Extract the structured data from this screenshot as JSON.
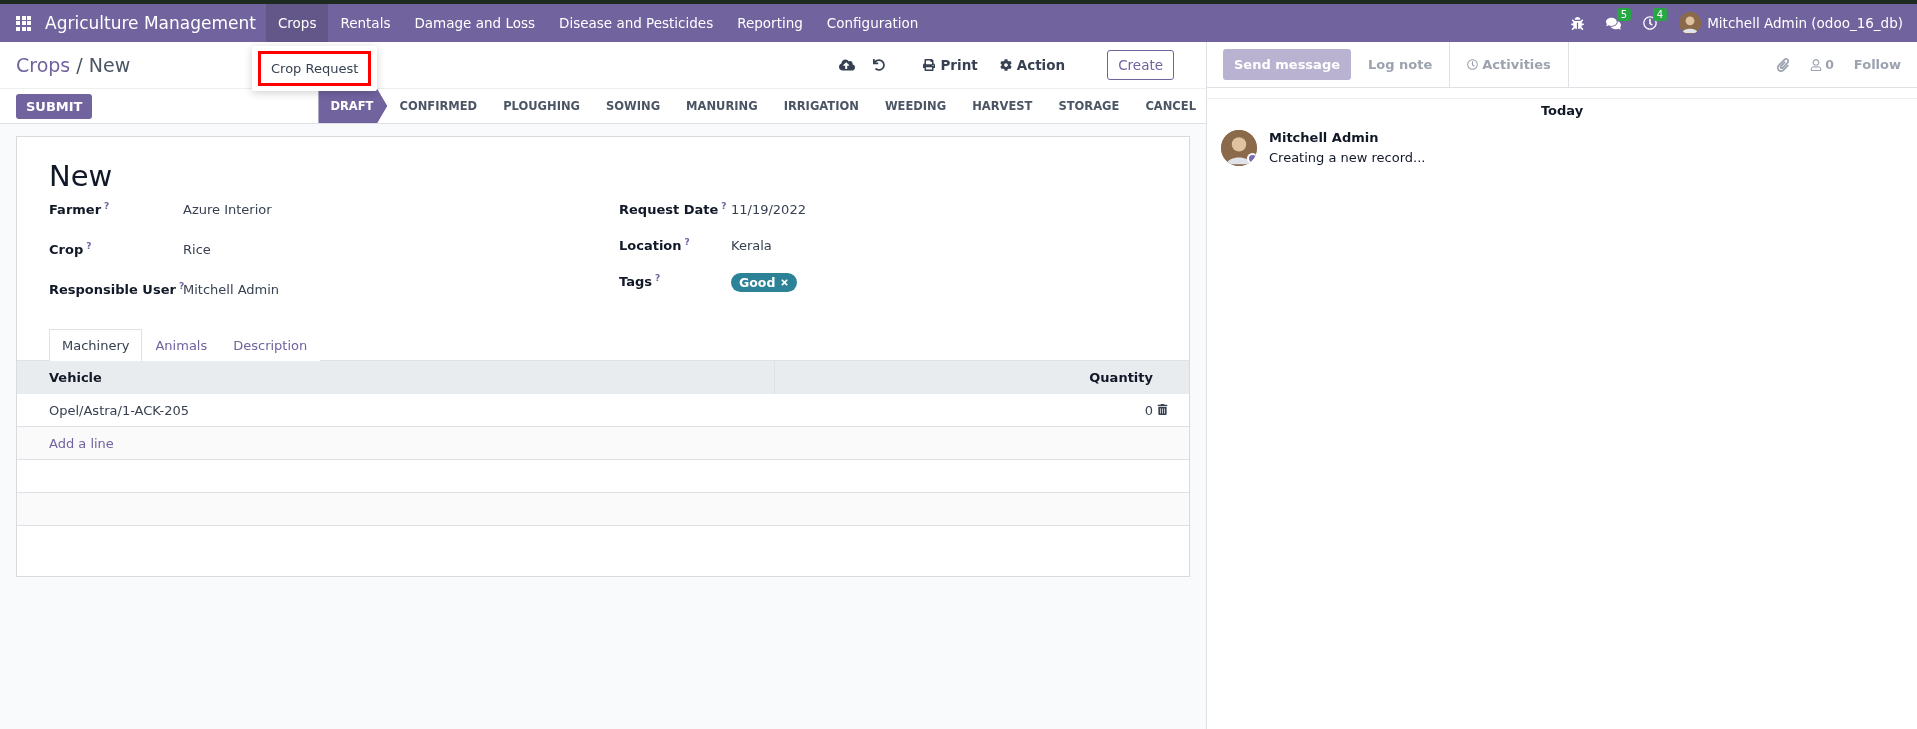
{
  "navbar": {
    "app_name": "Agriculture Management",
    "menus": [
      {
        "label": "Crops",
        "selected": true
      },
      {
        "label": "Rentals",
        "selected": false
      },
      {
        "label": "Damage and Loss",
        "selected": false
      },
      {
        "label": "Disease and Pesticides",
        "selected": false
      },
      {
        "label": "Reporting",
        "selected": false
      },
      {
        "label": "Configuration",
        "selected": false
      }
    ],
    "messages_count": "5",
    "activities_count": "4",
    "user": "Mitchell Admin (odoo_16_db)"
  },
  "dropdown": {
    "items": [
      {
        "label": "Crop Request",
        "highlighted": true
      }
    ]
  },
  "breadcrumb": {
    "parent": "Crops",
    "separator": "/",
    "current": "New"
  },
  "actions": {
    "print": "Print",
    "action": "Action",
    "create": "Create"
  },
  "submit": "SUBMIT",
  "stages": [
    {
      "label": "DRAFT",
      "selected": true
    },
    {
      "label": "CONFIRMED",
      "selected": false
    },
    {
      "label": "PLOUGHING",
      "selected": false
    },
    {
      "label": "SOWING",
      "selected": false
    },
    {
      "label": "MANURING",
      "selected": false
    },
    {
      "label": "IRRIGATION",
      "selected": false
    },
    {
      "label": "WEEDING",
      "selected": false
    },
    {
      "label": "HARVEST",
      "selected": false
    },
    {
      "label": "STORAGE",
      "selected": false
    },
    {
      "label": "CANCEL",
      "selected": false
    }
  ],
  "form": {
    "title": "New",
    "left_fields": [
      {
        "label": "Farmer",
        "help": "?",
        "value": "Azure Interior"
      },
      {
        "label": "Crop",
        "help": "?",
        "value": "Rice"
      },
      {
        "label": "Responsible User",
        "help": "?",
        "value": "Mitchell Admin"
      }
    ],
    "right_fields": [
      {
        "label": "Request Date",
        "help": "?",
        "value": "11/19/2022",
        "kind": "text"
      },
      {
        "label": "Location",
        "help": "?",
        "value": "Kerala",
        "kind": "text"
      },
      {
        "label": "Tags",
        "help": "?",
        "value": "Good",
        "kind": "tag",
        "color": "#2c8397"
      }
    ],
    "tabs": [
      {
        "label": "Machinery",
        "selected": true
      },
      {
        "label": "Animals",
        "selected": false
      },
      {
        "label": "Description",
        "selected": false
      }
    ],
    "table": {
      "columns": [
        "Vehicle",
        "Quantity"
      ],
      "rows": [
        {
          "vehicle": "Opel/Astra/1-ACK-205",
          "quantity": "0"
        }
      ],
      "add_line": "Add a line"
    }
  },
  "chatter": {
    "send_message": "Send message",
    "log_note": "Log note",
    "activities": "Activities",
    "followers_count": "0",
    "follow": "Follow",
    "date_separator": "Today",
    "messages": [
      {
        "author": "Mitchell Admin",
        "body": "Creating a new record..."
      }
    ]
  }
}
